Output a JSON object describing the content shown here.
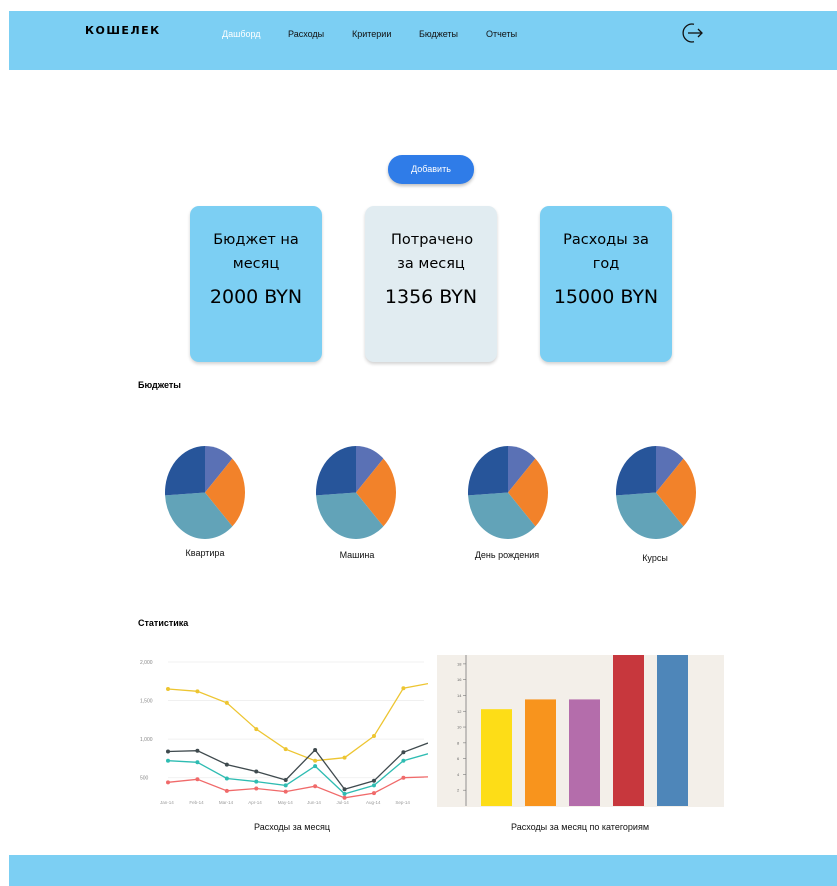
{
  "header": {
    "logo": "КОШЕЛЕК",
    "nav": [
      "Дашборд",
      "Расходы",
      "Критерии",
      "Бюджеты",
      "Отчеты"
    ],
    "active_nav": "Дашборд",
    "logout_icon": "logout-icon"
  },
  "actions": {
    "add_label": "Добавить"
  },
  "cards": [
    {
      "title": "Бюджет на месяц",
      "value": "2000 BYN",
      "color": "#7ccff3"
    },
    {
      "title": "Потрачено за месяц",
      "value": "1356 BYN",
      "color": "#e1ecf1"
    },
    {
      "title": "Расходы за год",
      "value": "15000 BYN",
      "color": "#7ccff3"
    }
  ],
  "budgets": {
    "title": "Бюджеты",
    "items": [
      "Квартира",
      "Машина",
      "День рождения",
      "Курсы"
    ],
    "pie_colors": [
      "#5a71b5",
      "#f2822a",
      "#62a3b8",
      "#27559a"
    ]
  },
  "stats": {
    "title": "Статистика",
    "line_caption": "Расходы за месяц",
    "bar_caption": "Расходы за месяц по категориям"
  },
  "chart_data": [
    {
      "type": "pie",
      "title": "Квартира",
      "values": [
        12,
        26,
        36,
        26
      ],
      "colors": [
        "#5a71b5",
        "#f2822a",
        "#62a3b8",
        "#27559a"
      ]
    },
    {
      "type": "pie",
      "title": "Машина",
      "values": [
        12,
        26,
        36,
        26
      ],
      "colors": [
        "#5a71b5",
        "#f2822a",
        "#62a3b8",
        "#27559a"
      ]
    },
    {
      "type": "pie",
      "title": "День рождения",
      "values": [
        12,
        26,
        36,
        26
      ],
      "colors": [
        "#5a71b5",
        "#f2822a",
        "#62a3b8",
        "#27559a"
      ]
    },
    {
      "type": "pie",
      "title": "Курсы",
      "values": [
        12,
        26,
        36,
        26
      ],
      "colors": [
        "#5a71b5",
        "#f2822a",
        "#62a3b8",
        "#27559a"
      ]
    },
    {
      "type": "line",
      "title": "Расходы за месяц",
      "categories": [
        "Jan-14",
        "Feb-14",
        "Mar-14",
        "Apr-14",
        "May-14",
        "Jun-14",
        "Jul-14",
        "Aug-14",
        "Sep-14"
      ],
      "yticks": [
        "2,000",
        "1,500",
        "1,000",
        "500"
      ],
      "ylim": [
        250,
        2000
      ],
      "series": [
        {
          "color": "#edc531",
          "values": [
            1650,
            1620,
            1470,
            1130,
            870,
            720,
            760,
            1040,
            1660,
            1720
          ]
        },
        {
          "color": "#3f4a4e",
          "values": [
            840,
            850,
            670,
            580,
            470,
            860,
            350,
            460,
            830,
            950
          ]
        },
        {
          "color": "#2ebcb2",
          "values": [
            720,
            700,
            490,
            450,
            400,
            650,
            290,
            400,
            720,
            810
          ]
        },
        {
          "color": "#f06a6a",
          "values": [
            440,
            480,
            330,
            360,
            320,
            390,
            240,
            300,
            500,
            510
          ]
        }
      ]
    },
    {
      "type": "bar",
      "title": "Расходы за месяц по категориям",
      "yticks": [
        "18",
        "16",
        "14",
        "12",
        "10",
        "8",
        "6",
        "4",
        "2"
      ],
      "ylim": [
        0,
        17
      ],
      "values": [
        10.9,
        12,
        12,
        18,
        20
      ],
      "colors": [
        "#fddd17",
        "#f8941d",
        "#b46dab",
        "#c7373d",
        "#4e86b9"
      ]
    }
  ]
}
